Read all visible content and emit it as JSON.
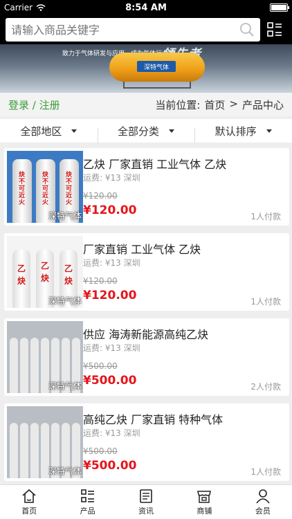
{
  "status_bar": {
    "carrier": "Carrier",
    "time": "8:54 AM"
  },
  "search": {
    "placeholder": "请输入商品关键字"
  },
  "banner": {
    "slogan": "致力于气体研发与应用，成为气体行业的",
    "brand": "领先者",
    "tank_logo": "深特气体"
  },
  "login": {
    "link": "登录 / 注册"
  },
  "breadcrumb": {
    "prefix": "当前位置:",
    "home": "首页",
    "separator": ">",
    "current": "产品中心"
  },
  "filters": [
    {
      "label": "全部地区"
    },
    {
      "label": "全部分类"
    },
    {
      "label": "默认排序"
    }
  ],
  "products": [
    {
      "title": "乙炔 厂家直销 工业气体 乙炔",
      "shipping": "运费: ¥13 深圳",
      "old_price": "¥120.00",
      "price": "¥120.00",
      "sold": "1人付款",
      "watermark": "深特气体",
      "image": "white-cylinders-text"
    },
    {
      "title": "厂家直销 工业气体 乙炔",
      "shipping": "运费: ¥13 深圳",
      "old_price": "¥120.00",
      "price": "¥120.00",
      "sold": "1人付款",
      "watermark": "深特气体",
      "image": "white-cylinders-yijue"
    },
    {
      "title": "供应 海涛新能源高纯乙炔",
      "shipping": "运费: ¥13 深圳",
      "old_price": "¥500.00",
      "price": "¥500.00",
      "sold": "2人付款",
      "watermark": "深特气体",
      "image": "cylinder-rack"
    },
    {
      "title": "高纯乙炔 厂家直销 特种气体",
      "shipping": "运费: ¥13 深圳",
      "old_price": "¥500.00",
      "price": "¥500.00",
      "sold": "1人付款",
      "watermark": "深特气体",
      "image": "cylinder-rack"
    }
  ],
  "cylinder_labels": {
    "product1": "炔不可近火",
    "product2": [
      "乙",
      "炔"
    ]
  },
  "tabs": [
    {
      "label": "首页",
      "icon": "home-icon"
    },
    {
      "label": "产品",
      "icon": "list-icon"
    },
    {
      "label": "资讯",
      "icon": "news-icon"
    },
    {
      "label": "商铺",
      "icon": "store-icon"
    },
    {
      "label": "会员",
      "icon": "user-icon"
    }
  ],
  "colors": {
    "accent_green": "#3a9c3a",
    "price_red": "#e4141b",
    "header_bg": "#000000"
  }
}
